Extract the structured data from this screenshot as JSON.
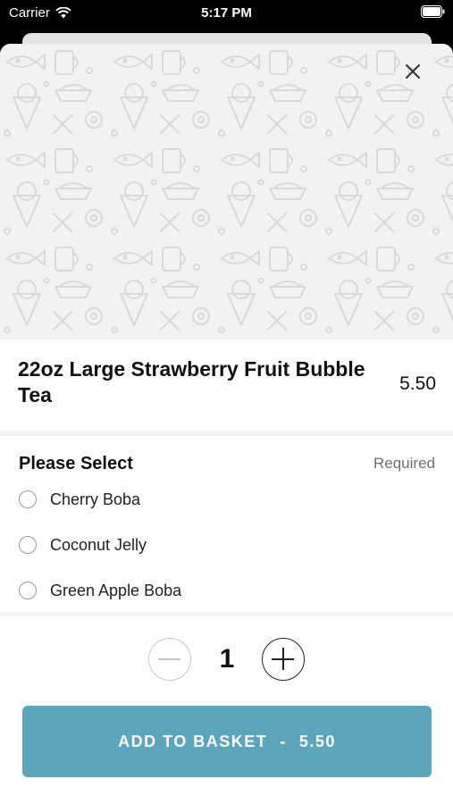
{
  "status_bar": {
    "carrier": "Carrier",
    "time": "5:17 PM"
  },
  "item": {
    "title": "22oz Large Strawberry Fruit Bubble Tea",
    "price": "5.50"
  },
  "options": {
    "heading": "Please Select",
    "required_label": "Required",
    "items": [
      {
        "label": "Cherry Boba"
      },
      {
        "label": "Coconut Jelly"
      },
      {
        "label": "Green Apple Boba"
      }
    ]
  },
  "quantity": "1",
  "add_button": {
    "label": "ADD TO BASKET",
    "separator": "-",
    "price": "5.50"
  },
  "colors": {
    "accent": "#5ba6bb",
    "hero_bg": "#f2f2f2",
    "doodle": "#dcdcdc"
  },
  "icons": [
    "wifi-icon",
    "battery-icon",
    "close-icon",
    "minus-icon",
    "plus-icon",
    "food-pattern"
  ]
}
